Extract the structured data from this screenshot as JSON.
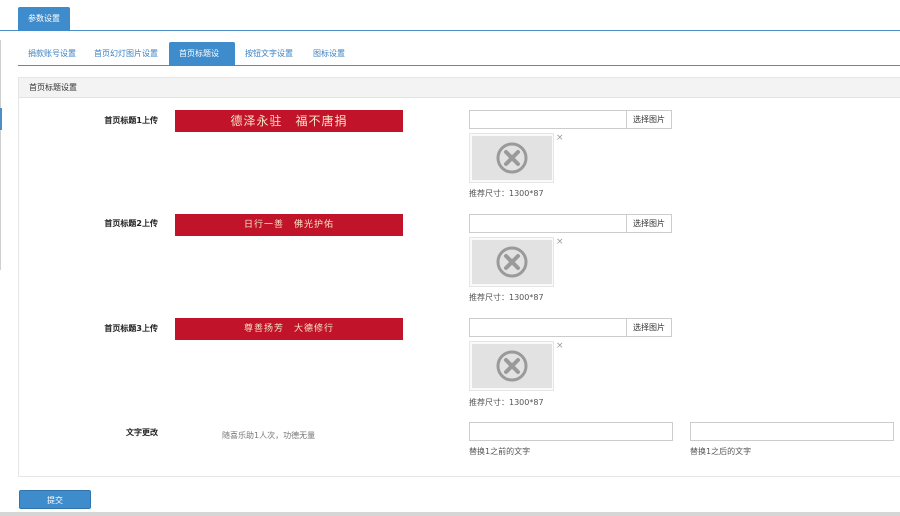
{
  "top_tab": "参数设置",
  "sub_tabs": [
    "捐款账号设置",
    "首页幻灯图片设置",
    "首页标题设置",
    "按钮文字设置",
    "图标设置"
  ],
  "panel_title": "首页标题设置",
  "uploads": [
    {
      "label": "首页标题1上传",
      "banner_text": "德泽永驻　福不唐捐",
      "choose_label": "选择图片",
      "size_hint": "推荐尺寸：1300*87"
    },
    {
      "label": "首页标题2上传",
      "banner_text": "日行一善　佛光护佑",
      "choose_label": "选择图片",
      "size_hint": "推荐尺寸：1300*87"
    },
    {
      "label": "首页标题3上传",
      "banner_text": "尊善扬芳　大德修行",
      "choose_label": "选择图片",
      "size_hint": "推荐尺寸：1300*87"
    }
  ],
  "text_change": {
    "label": "文字更改",
    "sample": "随喜乐助1人次，功德无量",
    "before_hint": "替换1之前的文字",
    "after_hint": "替换1之后的文字"
  },
  "close_glyph": "×",
  "submit_label": "提交",
  "colors": {
    "accent": "#3f8ccc",
    "banner": "#c1142a"
  }
}
